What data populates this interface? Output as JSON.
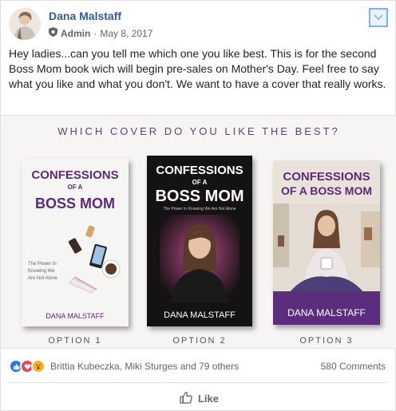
{
  "post": {
    "author": "Dana Malstaff",
    "role": "Admin",
    "separator": "·",
    "date": "May 8, 2017",
    "text": "Hey ladies...can you tell me which one you like best. This is for the second Boss Mom book wich will begin pre-sales on Mother's Day. Feel free to say what you like and what you don't. We want to have a cover that really works."
  },
  "image": {
    "heading": "WHICH COVER DO YOU LIKE THE BEST?",
    "books": [
      {
        "title_line1": "CONFESSIONS",
        "title_line2": "OF A",
        "title_line3": "BOSS MOM",
        "subtitle": "The Power In Knowing We Are Not Alone",
        "author": "DANA MALSTAFF",
        "option": "OPTION 1"
      },
      {
        "title_line1": "CONFESSIONS",
        "title_line2": "OF A",
        "title_line3": "BOSS MOM",
        "subtitle": "The Power In Knowing We Are Not Alone",
        "author": "DANA MALSTAFF",
        "option": "OPTION 2"
      },
      {
        "title_line1": "CONFESSIONS",
        "title_line2": "OF A BOSS MOM",
        "author": "DANA MALSTAFF",
        "option": "OPTION 3"
      }
    ]
  },
  "reactions": {
    "icons": [
      "like-icon",
      "love-icon",
      "wow-icon"
    ],
    "names": "Brittia Kubeczka, Miki Sturges and 79 others",
    "comments": "580 Comments"
  },
  "actions": {
    "like": "Like"
  },
  "colors": {
    "link": "#365899",
    "like_blue": "#2078f4",
    "love_red": "#f33e58",
    "wow_yellow": "#f7b125",
    "purple": "#5b2a7a"
  }
}
